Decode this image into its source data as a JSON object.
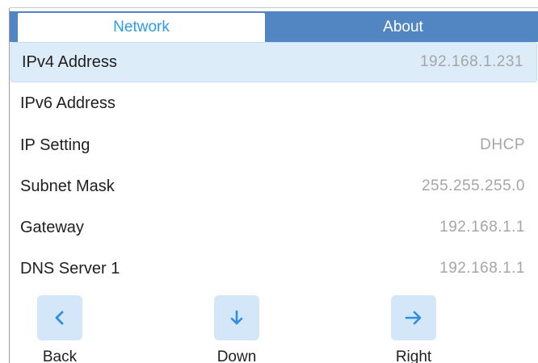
{
  "tabs": [
    {
      "label": "Network"
    },
    {
      "label": "About"
    }
  ],
  "rows": [
    {
      "label": "IPv4 Address",
      "value": "192.168.1.231"
    },
    {
      "label": "IPv6 Address",
      "value": ""
    },
    {
      "label": "IP Setting",
      "value": "DHCP"
    },
    {
      "label": "Subnet Mask",
      "value": "255.255.255.0"
    },
    {
      "label": "Gateway",
      "value": "192.168.1.1"
    },
    {
      "label": "DNS Server 1",
      "value": "192.168.1.1"
    }
  ],
  "nav": {
    "back_label": "Back",
    "down_label": "Down",
    "right_label": "Right",
    "back_icon": "chevron-left-icon",
    "down_icon": "arrow-down-icon",
    "right_icon": "arrow-right-icon"
  },
  "colors": {
    "tab_bar": "#5286c3",
    "active_tab_text": "#2a9ee8",
    "selected_row": "#dcecf8",
    "button_bg": "#d3e7f8",
    "icon": "#2f8de4"
  }
}
